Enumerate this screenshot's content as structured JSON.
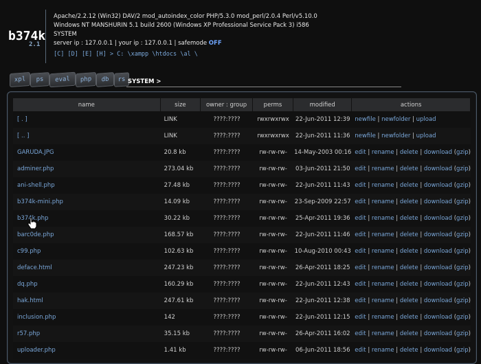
{
  "logo": {
    "name": "b374k",
    "version": "2.1"
  },
  "server_info": {
    "software": "Apache/2.2.12 (Win32) DAV/2 mod_autoindex_color PHP/5.3.0 mod_perl/2.0.4 Perl/v5.10.0",
    "os": "Windows NT MANSHURIN 5.1 build 2600 (Windows XP Professional Service Pack 3) i586",
    "user": "SYSTEM",
    "ip_line": "server ip : 127.0.0.1 | your ip : 127.0.0.1 | safemode ",
    "safemode": "OFF",
    "drives_path": "[C] [D] [E] [H] > C: \\xampp \\htdocs \\al \\"
  },
  "tabs": [
    "xpl",
    "ps",
    "eval",
    "php",
    "db",
    "rs"
  ],
  "current_tab": "SYSTEM >",
  "table": {
    "headers": [
      "name",
      "size",
      "owner : group",
      "perms",
      "modified",
      "actions"
    ],
    "rows": [
      {
        "name": "[ . ]",
        "size": "LINK",
        "owner": "????:????",
        "perms": "rwxrwxrwx",
        "modified": "22-Jun-2011 12:39",
        "actions": [
          "newfile",
          "newfolder",
          "upload"
        ]
      },
      {
        "name": "[ .. ]",
        "size": "LINK",
        "owner": "????:????",
        "perms": "rwxrwxrwx",
        "modified": "22-Jun-2011 11:36",
        "actions": [
          "newfile",
          "newfolder",
          "upload"
        ]
      },
      {
        "name": "GARUDA.JPG",
        "size": "20.8 kb",
        "owner": "????:????",
        "perms": "rw-rw-rw-",
        "modified": "14-May-2003 00:16",
        "actions": [
          "edit",
          "rename",
          "delete",
          "download",
          "gzip"
        ]
      },
      {
        "name": "adminer.php",
        "size": "273.04 kb",
        "owner": "????:????",
        "perms": "rw-rw-rw-",
        "modified": "03-Jun-2011 21:50",
        "actions": [
          "edit",
          "rename",
          "delete",
          "download",
          "gzip"
        ]
      },
      {
        "name": "ani-shell.php",
        "size": "27.48 kb",
        "owner": "????:????",
        "perms": "rw-rw-rw-",
        "modified": "22-Jun-2011 11:43",
        "actions": [
          "edit",
          "rename",
          "delete",
          "download",
          "gzip"
        ]
      },
      {
        "name": "b374k-mini.php",
        "size": "14.09 kb",
        "owner": "????:????",
        "perms": "rw-rw-rw-",
        "modified": "23-Sep-2009 22:57",
        "actions": [
          "edit",
          "rename",
          "delete",
          "download",
          "gzip"
        ]
      },
      {
        "name": "b374k.php",
        "size": "30.22 kb",
        "owner": "????:????",
        "perms": "rw-rw-rw-",
        "modified": "25-Apr-2011 19:36",
        "actions": [
          "edit",
          "rename",
          "delete",
          "download",
          "gzip"
        ]
      },
      {
        "name": "barc0de.php",
        "size": "168.57 kb",
        "owner": "????:????",
        "perms": "rw-rw-rw-",
        "modified": "22-Jun-2011 11:46",
        "actions": [
          "edit",
          "rename",
          "delete",
          "download",
          "gzip"
        ]
      },
      {
        "name": "c99.php",
        "size": "102.63 kb",
        "owner": "????:????",
        "perms": "rw-rw-rw-",
        "modified": "10-Aug-2010 00:43",
        "actions": [
          "edit",
          "rename",
          "delete",
          "download",
          "gzip"
        ]
      },
      {
        "name": "deface.html",
        "size": "247.23 kb",
        "owner": "????:????",
        "perms": "rw-rw-rw-",
        "modified": "26-Apr-2011 18:25",
        "actions": [
          "edit",
          "rename",
          "delete",
          "download",
          "gzip"
        ]
      },
      {
        "name": "dq.php",
        "size": "160.29 kb",
        "owner": "????:????",
        "perms": "rw-rw-rw-",
        "modified": "22-Jun-2011 12:43",
        "actions": [
          "edit",
          "rename",
          "delete",
          "download",
          "gzip"
        ]
      },
      {
        "name": "hak.html",
        "size": "247.61 kb",
        "owner": "????:????",
        "perms": "rw-rw-rw-",
        "modified": "22-Jun-2011 12:38",
        "actions": [
          "edit",
          "rename",
          "delete",
          "download",
          "gzip"
        ]
      },
      {
        "name": "inclusion.php",
        "size": "142",
        "owner": "????:????",
        "perms": "rw-rw-rw-",
        "modified": "22-Jun-2011 12:15",
        "actions": [
          "edit",
          "rename",
          "delete",
          "download",
          "gzip"
        ]
      },
      {
        "name": "r57.php",
        "size": "35.15 kb",
        "owner": "????:????",
        "perms": "rw-rw-rw-",
        "modified": "26-Apr-2011 16:02",
        "actions": [
          "edit",
          "rename",
          "delete",
          "download",
          "gzip"
        ]
      },
      {
        "name": "uploader.php",
        "size": "1.41 kb",
        "owner": "????:????",
        "perms": "rw-rw-rw-",
        "modified": "06-Jun-2011 18:56",
        "actions": [
          "edit",
          "rename",
          "delete",
          "download",
          "gzip"
        ]
      }
    ]
  },
  "colors": {
    "link": "#7aa7d9",
    "background": "#0f0f0f",
    "header_bg": "#2b2c2e",
    "border": "#4d5a69",
    "safemode": "#6fa6ff"
  },
  "icons": {
    "cursor": "hand-pointer-icon"
  }
}
